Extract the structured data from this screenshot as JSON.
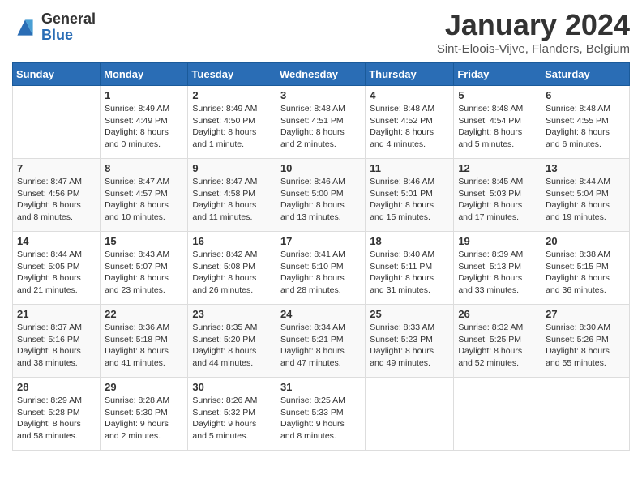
{
  "logo": {
    "general": "General",
    "blue": "Blue"
  },
  "title": "January 2024",
  "subtitle": "Sint-Eloois-Vijve, Flanders, Belgium",
  "days_of_week": [
    "Sunday",
    "Monday",
    "Tuesday",
    "Wednesday",
    "Thursday",
    "Friday",
    "Saturday"
  ],
  "weeks": [
    [
      {
        "day": "",
        "sunrise": "",
        "sunset": "",
        "daylight": ""
      },
      {
        "day": "1",
        "sunrise": "Sunrise: 8:49 AM",
        "sunset": "Sunset: 4:49 PM",
        "daylight": "Daylight: 8 hours and 0 minutes."
      },
      {
        "day": "2",
        "sunrise": "Sunrise: 8:49 AM",
        "sunset": "Sunset: 4:50 PM",
        "daylight": "Daylight: 8 hours and 1 minute."
      },
      {
        "day": "3",
        "sunrise": "Sunrise: 8:48 AM",
        "sunset": "Sunset: 4:51 PM",
        "daylight": "Daylight: 8 hours and 2 minutes."
      },
      {
        "day": "4",
        "sunrise": "Sunrise: 8:48 AM",
        "sunset": "Sunset: 4:52 PM",
        "daylight": "Daylight: 8 hours and 4 minutes."
      },
      {
        "day": "5",
        "sunrise": "Sunrise: 8:48 AM",
        "sunset": "Sunset: 4:54 PM",
        "daylight": "Daylight: 8 hours and 5 minutes."
      },
      {
        "day": "6",
        "sunrise": "Sunrise: 8:48 AM",
        "sunset": "Sunset: 4:55 PM",
        "daylight": "Daylight: 8 hours and 6 minutes."
      }
    ],
    [
      {
        "day": "7",
        "sunrise": "Sunrise: 8:47 AM",
        "sunset": "Sunset: 4:56 PM",
        "daylight": "Daylight: 8 hours and 8 minutes."
      },
      {
        "day": "8",
        "sunrise": "Sunrise: 8:47 AM",
        "sunset": "Sunset: 4:57 PM",
        "daylight": "Daylight: 8 hours and 10 minutes."
      },
      {
        "day": "9",
        "sunrise": "Sunrise: 8:47 AM",
        "sunset": "Sunset: 4:58 PM",
        "daylight": "Daylight: 8 hours and 11 minutes."
      },
      {
        "day": "10",
        "sunrise": "Sunrise: 8:46 AM",
        "sunset": "Sunset: 5:00 PM",
        "daylight": "Daylight: 8 hours and 13 minutes."
      },
      {
        "day": "11",
        "sunrise": "Sunrise: 8:46 AM",
        "sunset": "Sunset: 5:01 PM",
        "daylight": "Daylight: 8 hours and 15 minutes."
      },
      {
        "day": "12",
        "sunrise": "Sunrise: 8:45 AM",
        "sunset": "Sunset: 5:03 PM",
        "daylight": "Daylight: 8 hours and 17 minutes."
      },
      {
        "day": "13",
        "sunrise": "Sunrise: 8:44 AM",
        "sunset": "Sunset: 5:04 PM",
        "daylight": "Daylight: 8 hours and 19 minutes."
      }
    ],
    [
      {
        "day": "14",
        "sunrise": "Sunrise: 8:44 AM",
        "sunset": "Sunset: 5:05 PM",
        "daylight": "Daylight: 8 hours and 21 minutes."
      },
      {
        "day": "15",
        "sunrise": "Sunrise: 8:43 AM",
        "sunset": "Sunset: 5:07 PM",
        "daylight": "Daylight: 8 hours and 23 minutes."
      },
      {
        "day": "16",
        "sunrise": "Sunrise: 8:42 AM",
        "sunset": "Sunset: 5:08 PM",
        "daylight": "Daylight: 8 hours and 26 minutes."
      },
      {
        "day": "17",
        "sunrise": "Sunrise: 8:41 AM",
        "sunset": "Sunset: 5:10 PM",
        "daylight": "Daylight: 8 hours and 28 minutes."
      },
      {
        "day": "18",
        "sunrise": "Sunrise: 8:40 AM",
        "sunset": "Sunset: 5:11 PM",
        "daylight": "Daylight: 8 hours and 31 minutes."
      },
      {
        "day": "19",
        "sunrise": "Sunrise: 8:39 AM",
        "sunset": "Sunset: 5:13 PM",
        "daylight": "Daylight: 8 hours and 33 minutes."
      },
      {
        "day": "20",
        "sunrise": "Sunrise: 8:38 AM",
        "sunset": "Sunset: 5:15 PM",
        "daylight": "Daylight: 8 hours and 36 minutes."
      }
    ],
    [
      {
        "day": "21",
        "sunrise": "Sunrise: 8:37 AM",
        "sunset": "Sunset: 5:16 PM",
        "daylight": "Daylight: 8 hours and 38 minutes."
      },
      {
        "day": "22",
        "sunrise": "Sunrise: 8:36 AM",
        "sunset": "Sunset: 5:18 PM",
        "daylight": "Daylight: 8 hours and 41 minutes."
      },
      {
        "day": "23",
        "sunrise": "Sunrise: 8:35 AM",
        "sunset": "Sunset: 5:20 PM",
        "daylight": "Daylight: 8 hours and 44 minutes."
      },
      {
        "day": "24",
        "sunrise": "Sunrise: 8:34 AM",
        "sunset": "Sunset: 5:21 PM",
        "daylight": "Daylight: 8 hours and 47 minutes."
      },
      {
        "day": "25",
        "sunrise": "Sunrise: 8:33 AM",
        "sunset": "Sunset: 5:23 PM",
        "daylight": "Daylight: 8 hours and 49 minutes."
      },
      {
        "day": "26",
        "sunrise": "Sunrise: 8:32 AM",
        "sunset": "Sunset: 5:25 PM",
        "daylight": "Daylight: 8 hours and 52 minutes."
      },
      {
        "day": "27",
        "sunrise": "Sunrise: 8:30 AM",
        "sunset": "Sunset: 5:26 PM",
        "daylight": "Daylight: 8 hours and 55 minutes."
      }
    ],
    [
      {
        "day": "28",
        "sunrise": "Sunrise: 8:29 AM",
        "sunset": "Sunset: 5:28 PM",
        "daylight": "Daylight: 8 hours and 58 minutes."
      },
      {
        "day": "29",
        "sunrise": "Sunrise: 8:28 AM",
        "sunset": "Sunset: 5:30 PM",
        "daylight": "Daylight: 9 hours and 2 minutes."
      },
      {
        "day": "30",
        "sunrise": "Sunrise: 8:26 AM",
        "sunset": "Sunset: 5:32 PM",
        "daylight": "Daylight: 9 hours and 5 minutes."
      },
      {
        "day": "31",
        "sunrise": "Sunrise: 8:25 AM",
        "sunset": "Sunset: 5:33 PM",
        "daylight": "Daylight: 9 hours and 8 minutes."
      },
      {
        "day": "",
        "sunrise": "",
        "sunset": "",
        "daylight": ""
      },
      {
        "day": "",
        "sunrise": "",
        "sunset": "",
        "daylight": ""
      },
      {
        "day": "",
        "sunrise": "",
        "sunset": "",
        "daylight": ""
      }
    ]
  ]
}
